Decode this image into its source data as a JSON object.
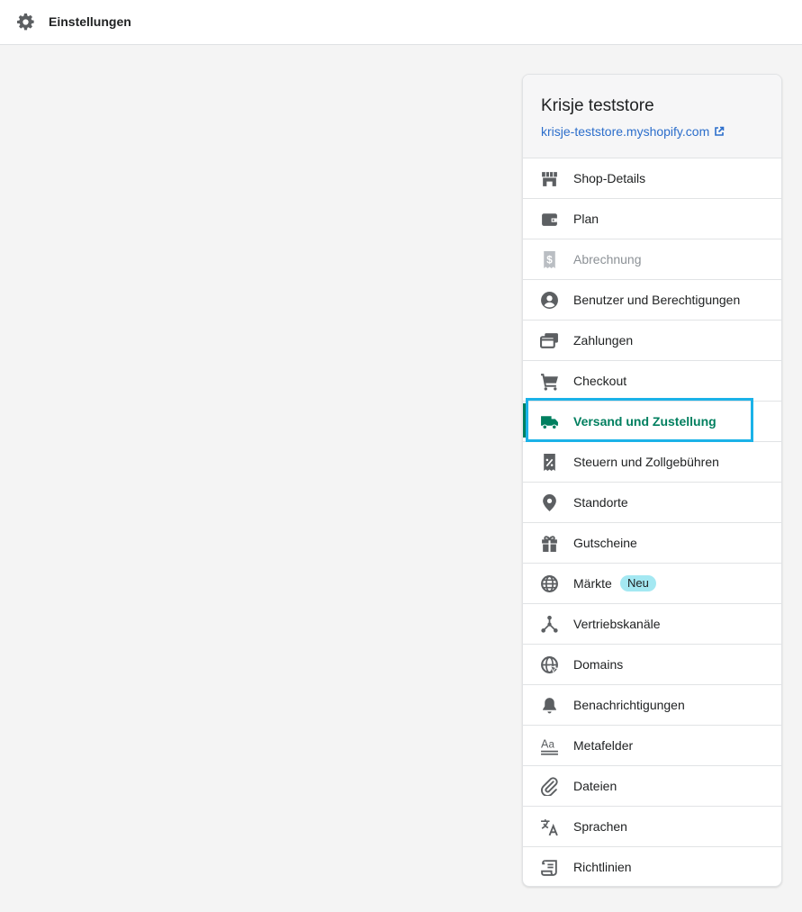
{
  "header": {
    "title": "Einstellungen",
    "icon": "gear-icon"
  },
  "store": {
    "name": "Krisje teststore",
    "url": "krisje-teststore.myshopify.com"
  },
  "colors": {
    "accent": "#008060",
    "link": "#2c6ecb",
    "highlight": "#1bb2e8",
    "badge": "#a4e8f2"
  },
  "nav": {
    "items": [
      {
        "label": "Shop-Details",
        "icon": "store-icon"
      },
      {
        "label": "Plan",
        "icon": "wallet-icon"
      },
      {
        "label": "Abrechnung",
        "icon": "billing-icon",
        "state": "disabled"
      },
      {
        "label": "Benutzer und Berechtigungen",
        "icon": "user-icon"
      },
      {
        "label": "Zahlungen",
        "icon": "payments-icon"
      },
      {
        "label": "Checkout",
        "icon": "cart-icon"
      },
      {
        "label": "Versand und Zustellung",
        "icon": "truck-icon",
        "state": "active"
      },
      {
        "label": "Steuern und Zollgebühren",
        "icon": "tax-icon"
      },
      {
        "label": "Standorte",
        "icon": "location-icon"
      },
      {
        "label": "Gutscheine",
        "icon": "gift-icon"
      },
      {
        "label": "Märkte",
        "icon": "globe-icon",
        "badge": "Neu"
      },
      {
        "label": "Vertriebskanäle",
        "icon": "channels-icon"
      },
      {
        "label": "Domains",
        "icon": "domains-icon"
      },
      {
        "label": "Benachrichtigungen",
        "icon": "bell-icon"
      },
      {
        "label": "Metafelder",
        "icon": "metafields-icon"
      },
      {
        "label": "Dateien",
        "icon": "paperclip-icon"
      },
      {
        "label": "Sprachen",
        "icon": "translate-icon"
      },
      {
        "label": "Richtlinien",
        "icon": "policy-icon"
      }
    ]
  }
}
